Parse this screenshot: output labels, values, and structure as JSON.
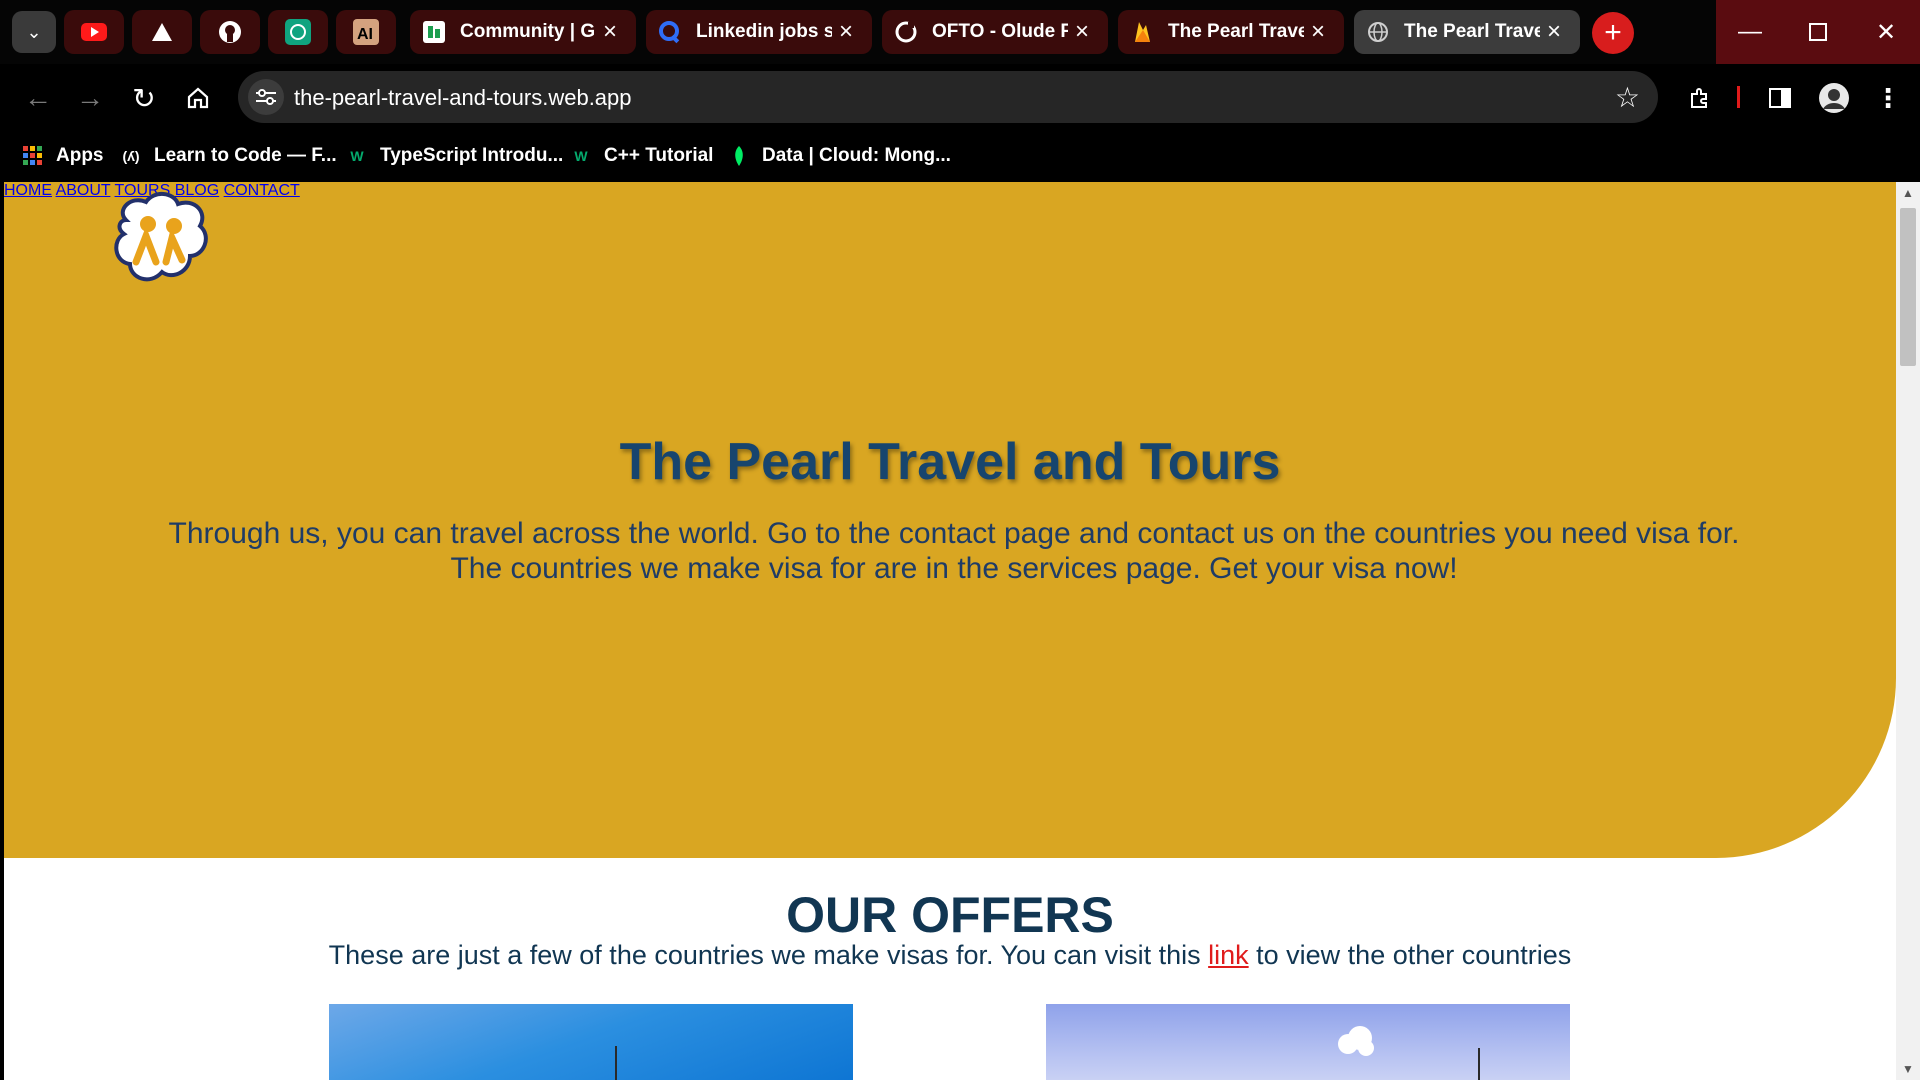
{
  "browser": {
    "tabs": [
      {
        "title": "Community | Gl",
        "favicon": "community-favicon"
      },
      {
        "title": "Linkedin jobs sc",
        "favicon": "linkedin-jobs-favicon"
      },
      {
        "title": "OFTO - Olude Fi",
        "favicon": "ofto-favicon"
      },
      {
        "title": "The Pearl Travel",
        "favicon": "firebase-favicon"
      },
      {
        "title": "The Pearl Travel",
        "favicon": "globe-favicon",
        "active": true
      }
    ],
    "pinned": [
      "youtube-icon",
      "drive-icon",
      "github-icon",
      "chatgpt-icon",
      "anthropic-icon"
    ],
    "url": "the-pearl-travel-and-tours.web.app",
    "bookmarks": [
      {
        "label": "Apps",
        "icon": "apps-grid-icon"
      },
      {
        "label": "Learn to Code — F...",
        "icon": "freecodecamp-icon"
      },
      {
        "label": "TypeScript Introdu...",
        "icon": "w3schools-icon"
      },
      {
        "label": "C++ Tutorial",
        "icon": "w3schools-icon"
      },
      {
        "label": "Data | Cloud: Mong...",
        "icon": "mongodb-leaf-icon"
      }
    ]
  },
  "site": {
    "nav": {
      "home": "HOME",
      "about": "ABOUT",
      "tours": "TOURS",
      "blog": "BLOG",
      "contact": "CONTACT"
    },
    "hero": {
      "title": "The Pearl Travel and Tours",
      "text_line1": "Through us, you can travel across the world. Go to the contact page and contact us on the countries you need visa for.",
      "text_line2": "The countries we make visa for are in the services page. Get your visa now!"
    },
    "offers": {
      "title": "OUR OFFERS",
      "text_before": "These are just a few of the countries we make visas for. You can visit this ",
      "link": "link",
      "text_after": " to view the other countries"
    }
  },
  "colors": {
    "hero_bg": "#d9a622",
    "accent_red": "#e01b1b",
    "heading_blue": "#17456e"
  }
}
